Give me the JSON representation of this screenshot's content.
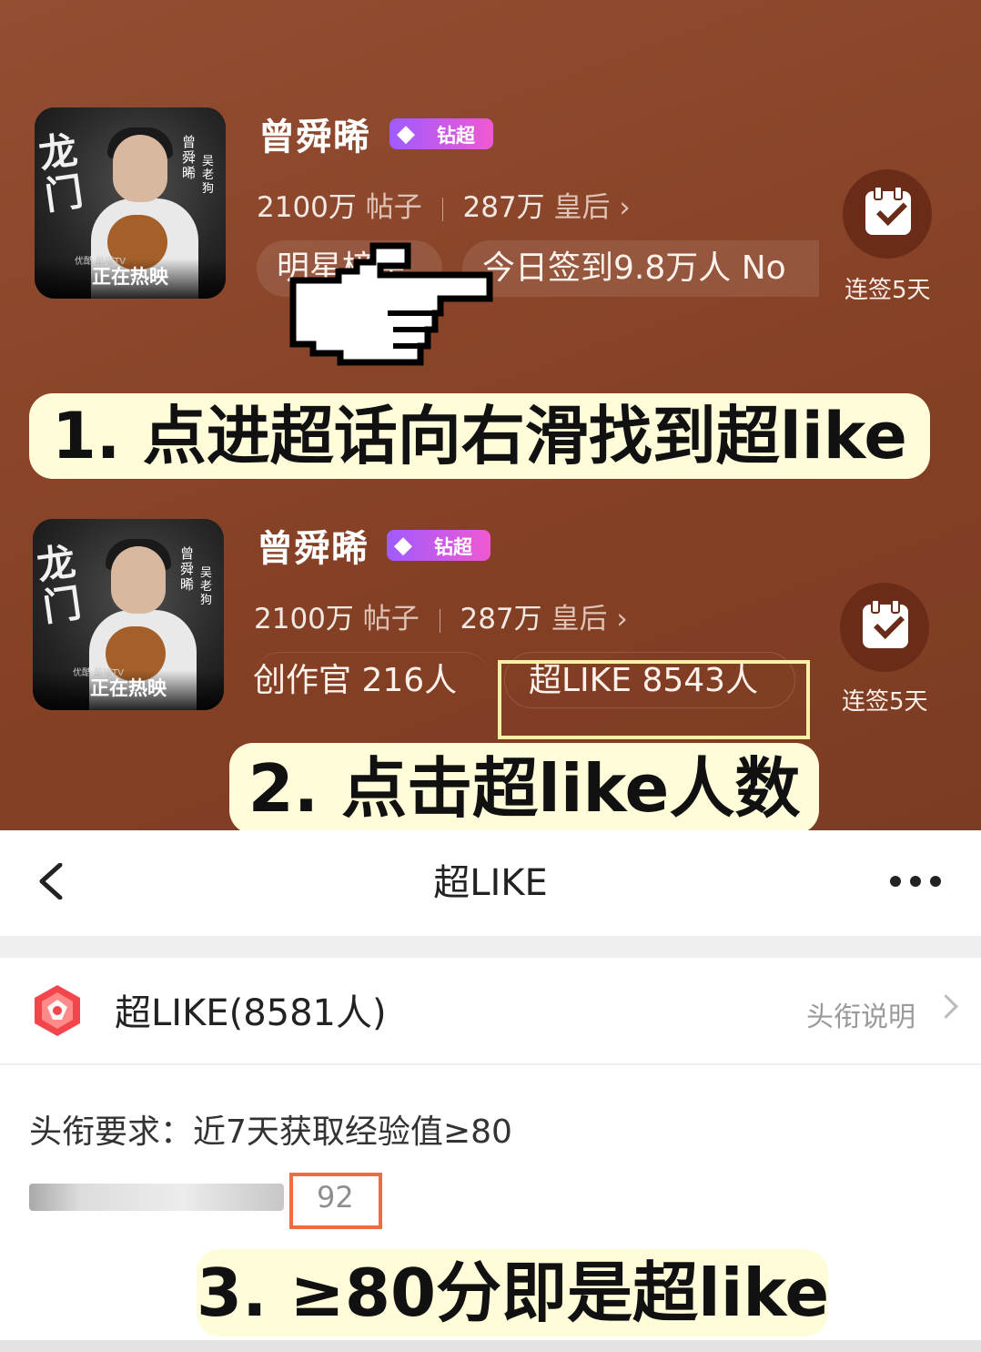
{
  "cards": [
    {
      "poster": {
        "logo": "龙门",
        "vertical_name": "曾舜晞",
        "vertical_role": "吴老狗",
        "sponsor": "优酷 酷喵TV",
        "banner": "正在热映"
      },
      "name": "曾舜晞",
      "vip_label": "钻超",
      "posts_count": "2100万",
      "posts_label": "帖子",
      "fans_count": "287万",
      "fans_label": "皇后",
      "pills": [
        "明星榜单",
        "今日签到9.8万人 No"
      ],
      "streak": "连签5天"
    },
    {
      "poster": {
        "logo": "龙门",
        "vertical_name": "曾舜晞",
        "vertical_role": "吴老狗",
        "sponsor": "优酷 酷喵TV",
        "banner": "正在热映"
      },
      "name": "曾舜晞",
      "vip_label": "钻超",
      "posts_count": "2100万",
      "posts_label": "帖子",
      "fans_count": "287万",
      "fans_label": "皇后",
      "pills": [
        "创作官 216人",
        "超LIKE 8543人"
      ],
      "streak": "连签5天"
    }
  ],
  "captions": {
    "step1": "1. 点进超话向右滑找到超like",
    "step2": "2. 点击超like人数",
    "step3": "3. ≥80分即是超like"
  },
  "nav": {
    "title": "超LIKE"
  },
  "title_row": {
    "label": "超LIKE(8581人)",
    "explain": "头衔说明"
  },
  "requirement": {
    "text": "头衔要求：近7天获取经验值≥80",
    "score": "92"
  },
  "colors": {
    "background": "#8d4427",
    "caption_bg": "#fffcd9",
    "highlight": "#f06c3e"
  }
}
